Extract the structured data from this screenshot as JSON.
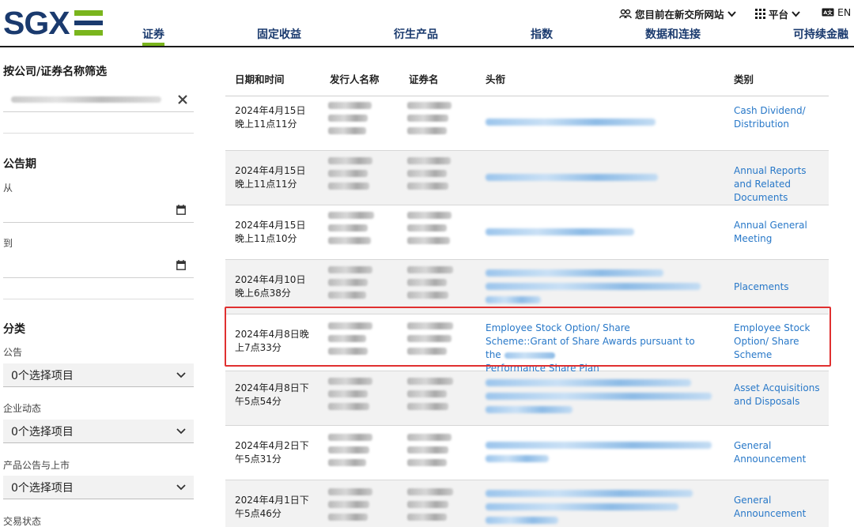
{
  "brand": {
    "logo_text": "SGX",
    "accent_green": "#7ab51d",
    "brand_blue": "#1a3a6e",
    "link_blue": "#2878c8",
    "highlight_red": "#e03030"
  },
  "utility": {
    "site_notice": "您目前在新交所网站",
    "platform": "平台",
    "lang": "EN"
  },
  "nav": [
    "证券",
    "固定收益",
    "衍生产品",
    "指数",
    "数据和连接",
    "可持续金融"
  ],
  "sidebar": {
    "filter_heading": "按公司/证券名称筛选",
    "period_heading": "公告期",
    "from_label": "从",
    "to_label": "到",
    "category_heading": "分类",
    "groups": [
      {
        "label": "公告",
        "selected": "0个选择项目"
      },
      {
        "label": "企业动态",
        "selected": "0个选择项目"
      },
      {
        "label": "产品公告与上市",
        "selected": "0个选择项目"
      }
    ],
    "trading_status_label": "交易状态"
  },
  "table": {
    "headers": [
      "日期和时间",
      "发行人名称",
      "证券名",
      "头衔",
      "类别"
    ],
    "rows": [
      {
        "date_l1": "2024年4月15日",
        "date_l2": "晚上11点11分",
        "headline": "",
        "category": "Cash Dividend/ Distribution"
      },
      {
        "date_l1": "2024年4月15日",
        "date_l2": "晚上11点11分",
        "headline": "",
        "category": "Annual Reports and Related Documents"
      },
      {
        "date_l1": "2024年4月15日",
        "date_l2": "晚上11点10分",
        "headline": "",
        "category": "Annual General Meeting"
      },
      {
        "date_l1": "2024年4月10日",
        "date_l2": "晚上6点38分",
        "headline": "",
        "category": "Placements"
      },
      {
        "date_l1": "2024年4月8日晚",
        "date_l2": "上7点33分",
        "headline": "Employee Stock Option/ Share Scheme::Grant of Share Awards pursuant to the",
        "category": "Employee Stock Option/ Share Scheme"
      },
      {
        "date_l1": "2024年4月8日下",
        "date_l2": "午5点54分",
        "headline": "",
        "category": "Asset Acquisitions and Disposals"
      },
      {
        "date_l1": "2024年4月2日下",
        "date_l2": "午5点31分",
        "headline": "",
        "category": "General Announcement"
      },
      {
        "date_l1": "2024年4月1日下",
        "date_l2": "午5点46分",
        "headline": "",
        "category": "General Announcement"
      }
    ],
    "highlight_headline_tail": "Performance Share Plan"
  }
}
